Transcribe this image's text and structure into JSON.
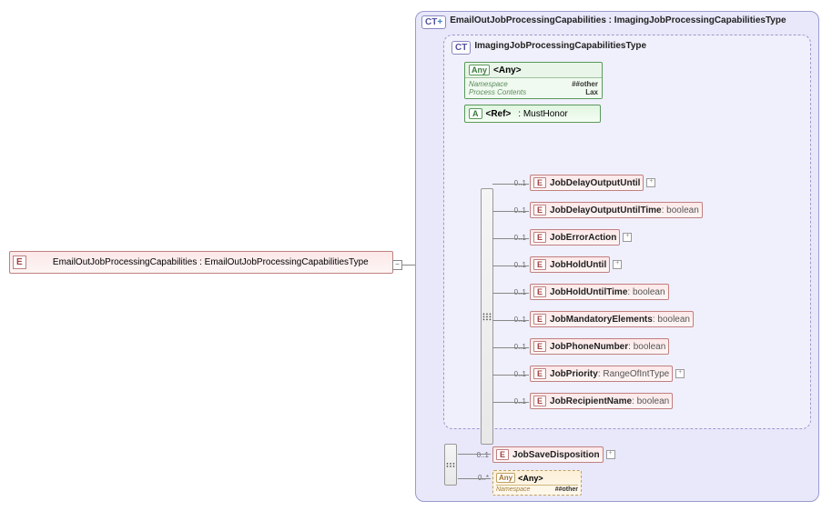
{
  "root": {
    "badge": "E",
    "label": "EmailOutJobProcessingCapabilities : EmailOutJobProcessingCapabilitiesType"
  },
  "ct_outer": {
    "badge": "CT",
    "title": "EmailOutJobProcessingCapabilities : ImagingJobProcessingCapabilitiesType"
  },
  "ct_inner": {
    "badge": "CT",
    "title": "ImagingJobProcessingCapabilitiesType"
  },
  "any_top": {
    "badge": "Any",
    "label": "<Any>",
    "namespace_k": "Namespace",
    "namespace_v": "##other",
    "process_k": "Process Contents",
    "process_v": "Lax"
  },
  "ref": {
    "badge": "A",
    "label": "<Ref>",
    "value": ": MustHonor"
  },
  "inner_children": [
    {
      "occ": "0..1",
      "name": "JobDelayOutputUntil",
      "type": "",
      "expand": true
    },
    {
      "occ": "0..1",
      "name": "JobDelayOutputUntilTime",
      "type": " : boolean",
      "expand": false
    },
    {
      "occ": "0..1",
      "name": "JobErrorAction",
      "type": "",
      "expand": true
    },
    {
      "occ": "0..1",
      "name": "JobHoldUntil",
      "type": "",
      "expand": true
    },
    {
      "occ": "0..1",
      "name": "JobHoldUntilTime",
      "type": " : boolean",
      "expand": false
    },
    {
      "occ": "0..1",
      "name": "JobMandatoryElements",
      "type": " : boolean",
      "expand": false
    },
    {
      "occ": "0..1",
      "name": "JobPhoneNumber",
      "type": " : boolean",
      "expand": false
    },
    {
      "occ": "0..1",
      "name": "JobPriority",
      "type": " : RangeOfIntType",
      "expand": true
    },
    {
      "occ": "0..1",
      "name": "JobRecipientName",
      "type": " : boolean",
      "expand": false
    }
  ],
  "outer_child": {
    "occ": "0..1",
    "name": "JobSaveDisposition",
    "type": "",
    "expand": true
  },
  "any_bottom": {
    "occ": "0..*",
    "badge": "Any",
    "label": "<Any>",
    "namespace_k": "Namespace",
    "namespace_v": "##other"
  },
  "e_badge": "E"
}
